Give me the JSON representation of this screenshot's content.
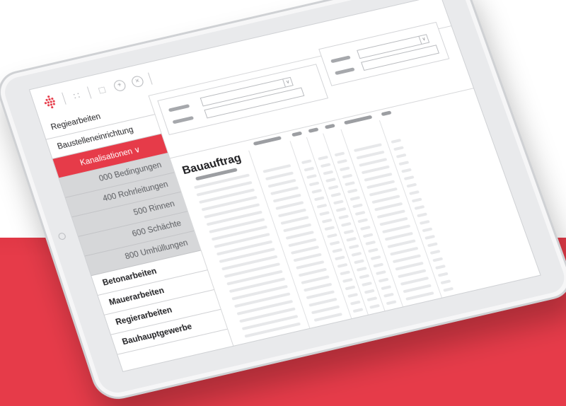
{
  "colors": {
    "accent": "#e63b49",
    "frame": "#e9eaec",
    "submenu_bg": "#d6d7d9"
  },
  "toolbar": {
    "icons": [
      "logo-icon",
      "grid-icon",
      "document-icon",
      "add-icon",
      "close-icon"
    ]
  },
  "window_controls": [
    "add-icon",
    "minus-icon",
    "close-icon"
  ],
  "sidebar": {
    "items": [
      {
        "label": "Regiearbeiten"
      },
      {
        "label": "Baustelleneinrichtung"
      },
      {
        "label": "Kanalisationen ∨"
      },
      {
        "label": "000 Bedingungen"
      },
      {
        "label": "400 Rohrleitungen"
      },
      {
        "label": "500 Rinnen"
      },
      {
        "label": "600 Schächte"
      },
      {
        "label": "800 Umhüllungen"
      },
      {
        "label": "Betonarbeiten"
      },
      {
        "label": "Mauerarbeiten"
      },
      {
        "label": "Regierarbeiten"
      },
      {
        "label": "Bauhauptgewerbe"
      }
    ]
  },
  "main": {
    "title": "Bauauftrag"
  }
}
